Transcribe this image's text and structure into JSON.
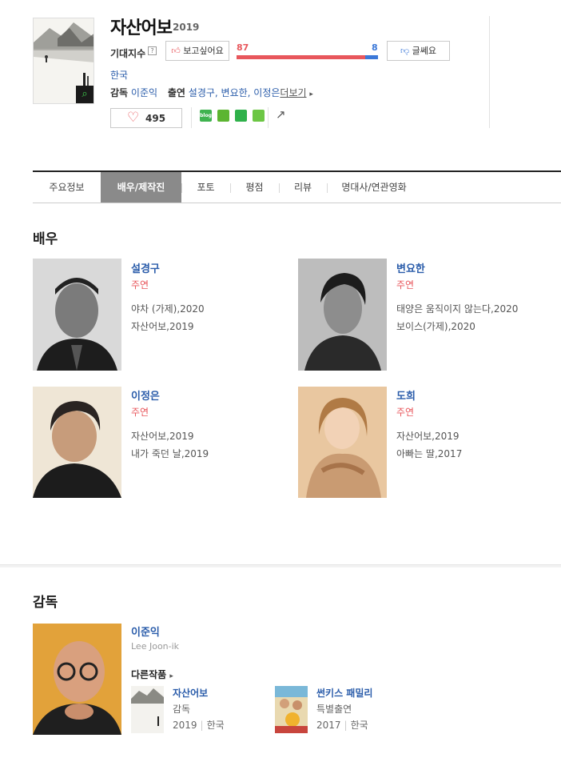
{
  "movie": {
    "title": "자산어보",
    "year": "2019",
    "expect_label": "기대지수",
    "help_icon": "?",
    "want_label": "보고싶어요",
    "nope_label": "글쎄요",
    "want_count": "87",
    "nope_count": "8",
    "want_ratio": 0.91,
    "country": "한국",
    "director_label": "감독",
    "director": "이준익",
    "cast_label": "출연",
    "cast": "설경구, 변요한, 이정은",
    "more": "더보기",
    "like_count": "495"
  },
  "sns": [
    {
      "name": "blog-icon",
      "text": "blog",
      "color": "#3fb34f"
    },
    {
      "name": "kakaostory-icon",
      "text": "",
      "color": "#5cb531"
    },
    {
      "name": "bookmark-icon",
      "text": "",
      "color": "#2fb14a"
    },
    {
      "name": "memo-icon",
      "text": "",
      "color": "#6cc644"
    }
  ],
  "tabs": [
    "주요정보",
    "배우/제작진",
    "포토",
    "평점",
    "리뷰",
    "명대사/연관영화"
  ],
  "actors_title": "배우",
  "actors": [
    {
      "name": "설경구",
      "role": "주연",
      "works": [
        "야차 (가제),2020",
        "자산어보,2019"
      ]
    },
    {
      "name": "변요한",
      "role": "주연",
      "works": [
        "태양은 움직이지 않는다,2020",
        "보이스(가제),2020"
      ]
    },
    {
      "name": "이정은",
      "role": "주연",
      "works": [
        "자산어보,2019",
        "내가 죽던 날,2019"
      ]
    },
    {
      "name": "도희",
      "role": "주연",
      "works": [
        "자산어보,2019",
        "아빠는 딸,2017"
      ]
    }
  ],
  "director_section": {
    "title": "감독",
    "name": "이준익",
    "english": "Lee Joon-ik",
    "other_label": "다른작품",
    "works": [
      {
        "title": "자산어보",
        "role": "감독",
        "year": "2019",
        "country": "한국"
      },
      {
        "title": "썬키스 패밀리",
        "role": "특별출연",
        "year": "2017",
        "country": "한국"
      }
    ]
  },
  "colors": {
    "accent_red": "#e8575c",
    "accent_blue": "#3b78d8",
    "link": "#2a5caa"
  }
}
